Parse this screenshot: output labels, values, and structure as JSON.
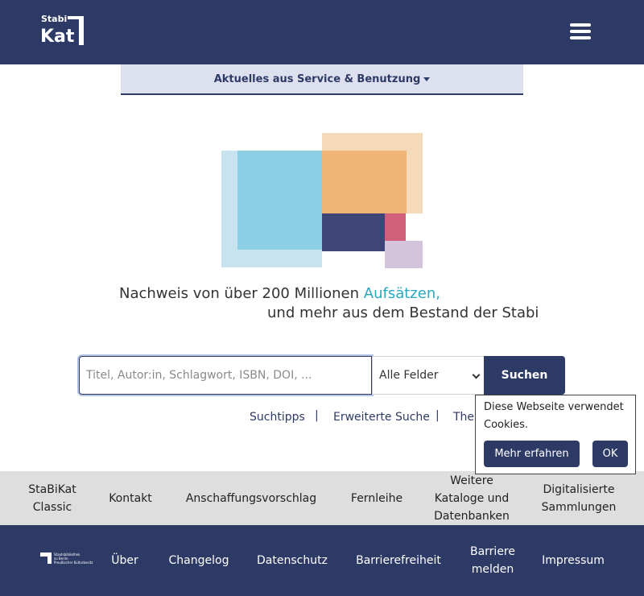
{
  "header": {
    "logo_line1": "Stabi",
    "logo_line2": "Kat",
    "menu_icon": "hamburger-menu-icon"
  },
  "news": {
    "label": "Aktuelles aus Service & Benutzung"
  },
  "tagline": {
    "line1_prefix": "Nachweis von über 200 Millionen ",
    "line1_accent": "Aufsätzen,",
    "line2": "und mehr aus dem Bestand der Stabi",
    "accent_color": "#2ba8c0"
  },
  "search": {
    "placeholder": "Titel, Autor:in, Schlagwort, ISBN, DOI, ...",
    "value": "",
    "field_selected": "Alle Felder",
    "button_label": "Suchen"
  },
  "search_links": {
    "tips": "Suchtipps",
    "advanced": "Erweiterte Suche",
    "third": "The",
    "separator": "|"
  },
  "cookie": {
    "message": "Diese Webseite verwendet Cookies.",
    "more_label": "Mehr erfahren",
    "ok_label": "OK"
  },
  "nav": {
    "stabikat_classic": "StaBiKat Classic",
    "kontakt": "Kontakt",
    "anschaffung": "Anschaffungsvorschlag",
    "fernleihe": "Fernleihe",
    "weitere_kataloge": "Weitere Kataloge und Datenbanken",
    "digitalisierte": "Digitalisierte Sammlungen"
  },
  "footer": {
    "logo_text_1": "Staatsbibliothek",
    "logo_text_2": "zu Berlin",
    "logo_text_3": "Preußischer Kulturbesitz",
    "ueber": "Über",
    "changelog": "Changelog",
    "datenschutz": "Datenschutz",
    "barrierefreiheit": "Barrierefreiheit",
    "barriere_melden": "Barriere melden",
    "impressum": "Impressum"
  },
  "colors": {
    "brand_navy": "#2e3a66",
    "nav_strip": "#dedede",
    "news_bar": "#dde1ef"
  }
}
